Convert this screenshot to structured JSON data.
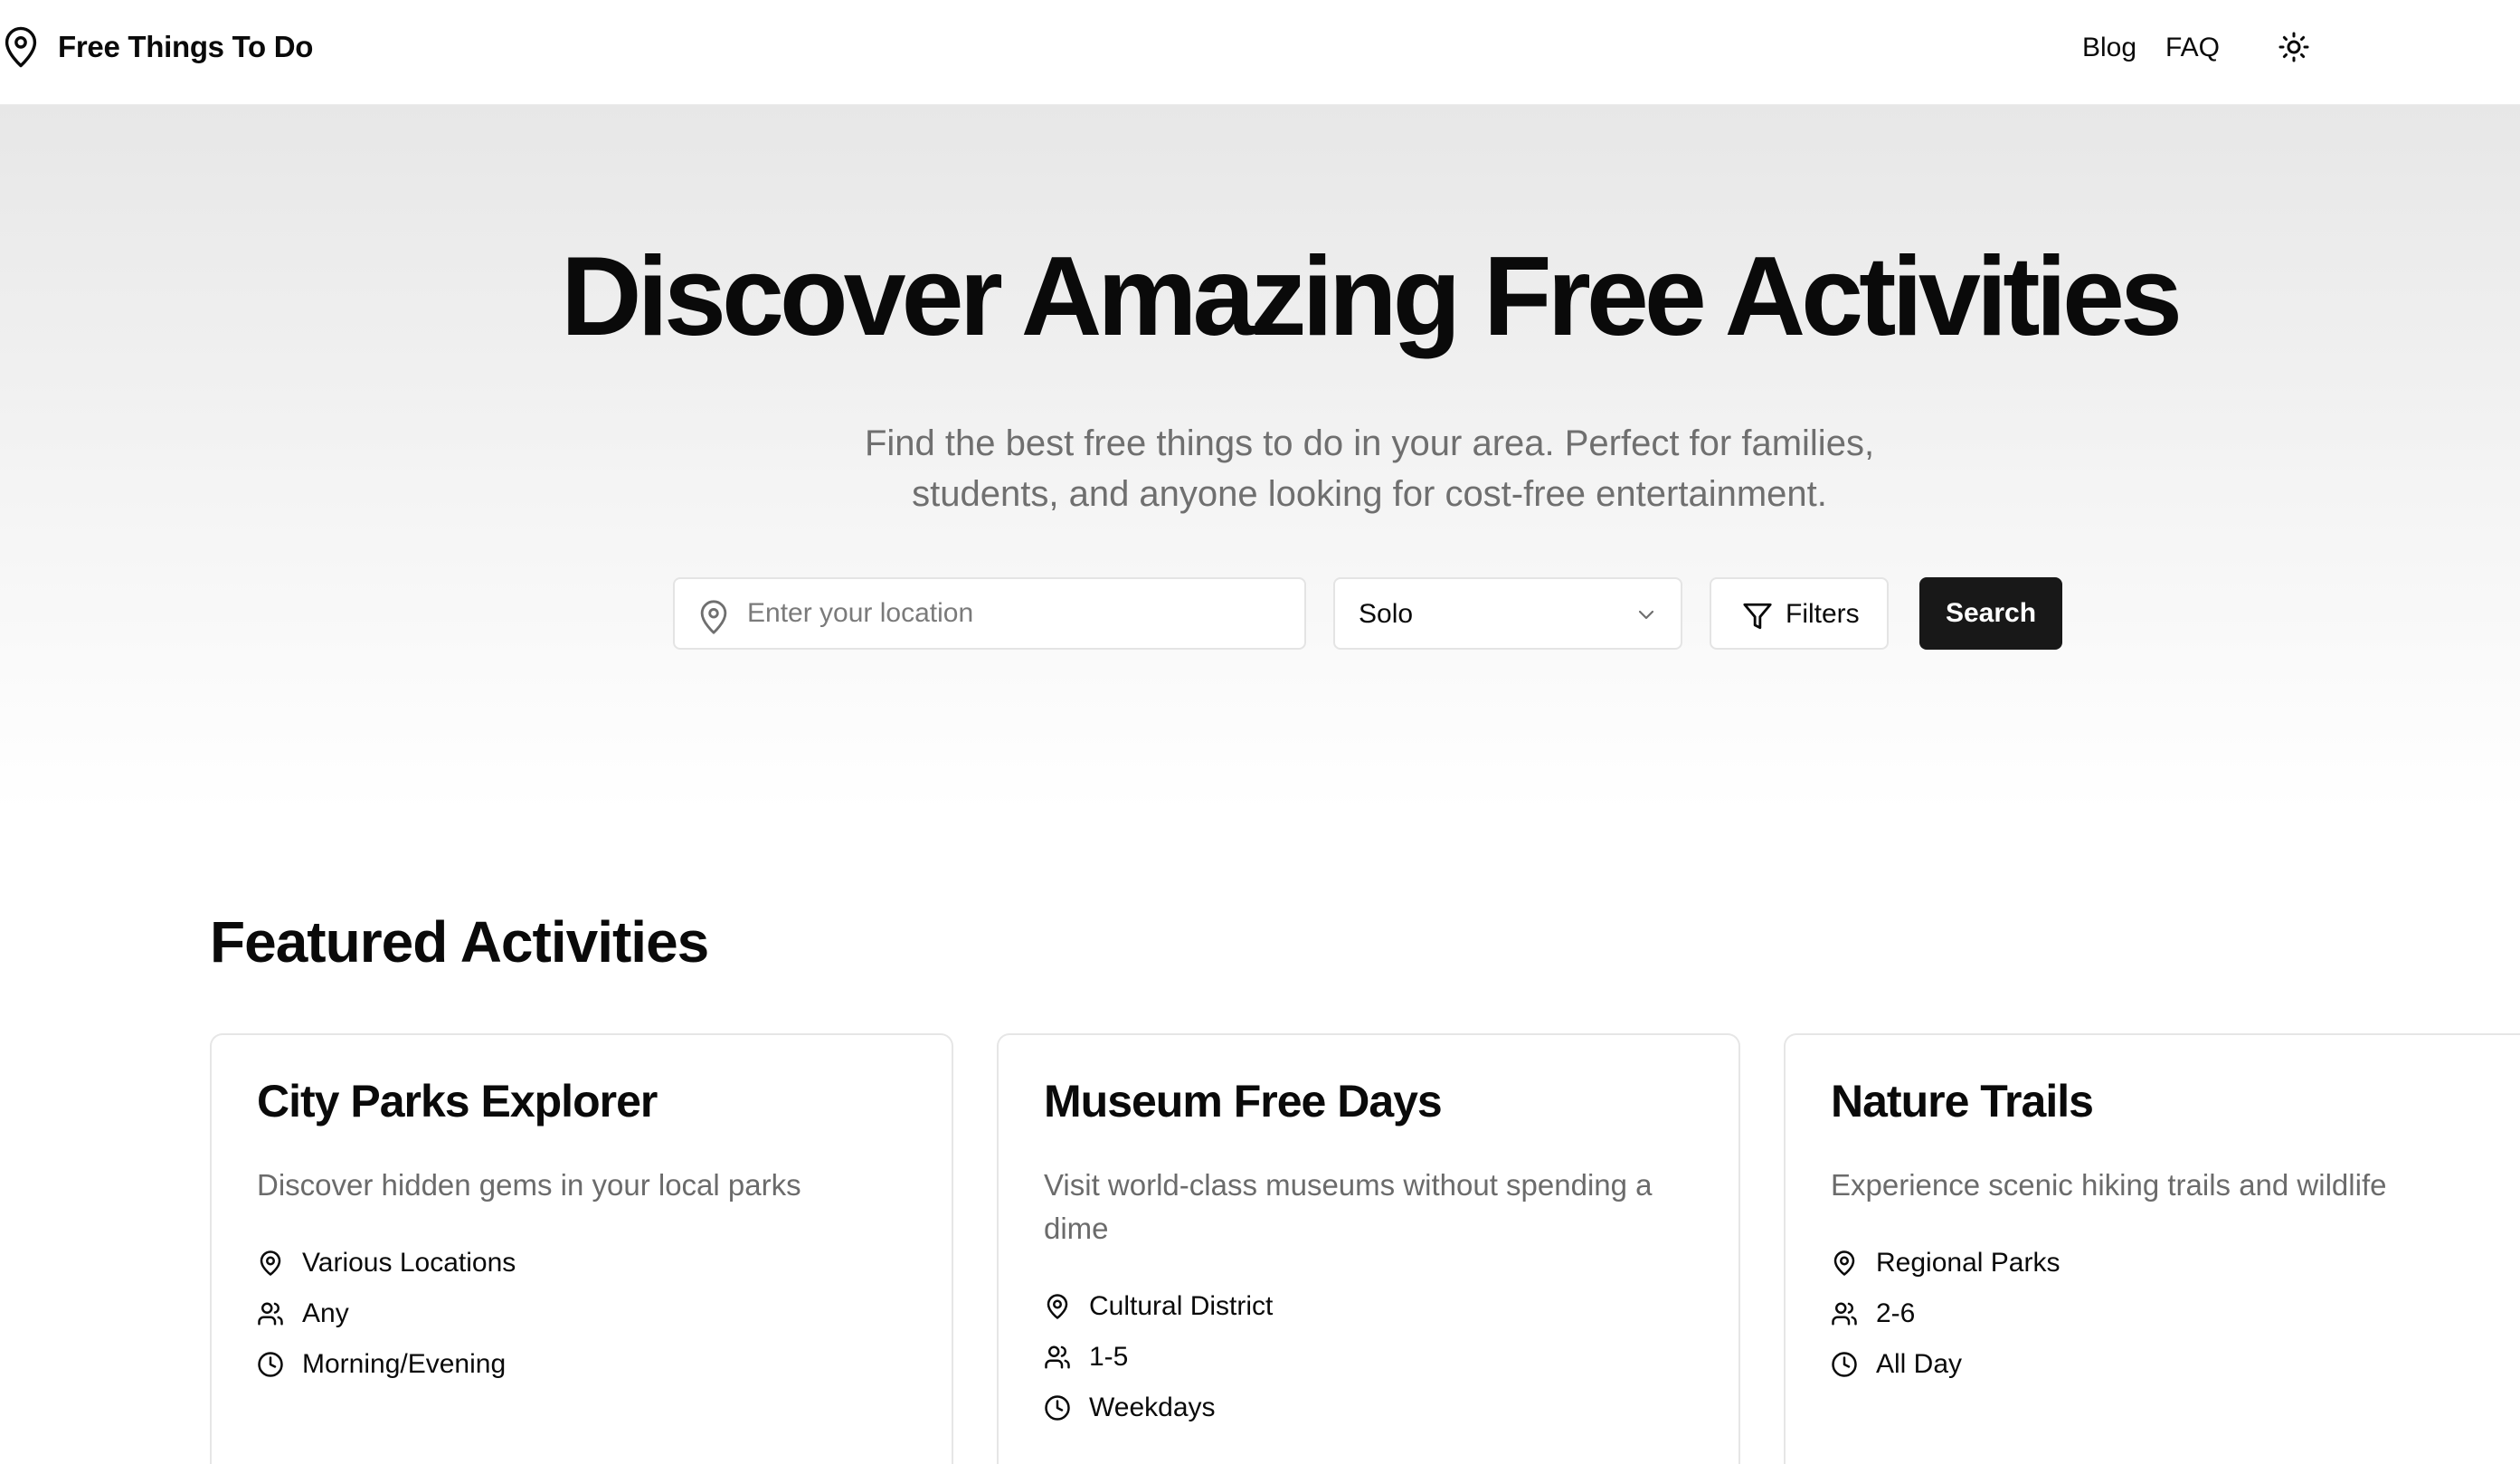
{
  "header": {
    "brand_name": "Free Things To Do",
    "nav": {
      "blog": "Blog",
      "faq": "FAQ"
    },
    "theme_icon": "sun-icon"
  },
  "hero": {
    "title": "Discover Amazing Free Activities",
    "subtitle_line1": "Find the best free things to do in your area. Perfect for families,",
    "subtitle_line2": "students, and anyone looking for cost-free entertainment.",
    "location_placeholder": "Enter your location",
    "group_select_value": "Solo",
    "filters_label": "Filters",
    "search_label": "Search"
  },
  "featured": {
    "title": "Featured Activities",
    "cards": [
      {
        "title": "City Parks Explorer",
        "description": "Discover hidden gems in your local parks",
        "location": "Various Locations",
        "group": "Any",
        "time": "Morning/Evening"
      },
      {
        "title": "Museum Free Days",
        "description": "Visit world-class museums without spending a dime",
        "location": "Cultural District",
        "group": "1-5",
        "time": "Weekdays"
      },
      {
        "title": "Nature Trails",
        "description": "Experience scenic hiking trails and wildlife",
        "location": "Regional Parks",
        "group": "2-6",
        "time": "All Day"
      }
    ]
  },
  "colors": {
    "primary_button": "#181818",
    "muted_text": "#6b6b6b",
    "border": "#e4e4e4"
  }
}
